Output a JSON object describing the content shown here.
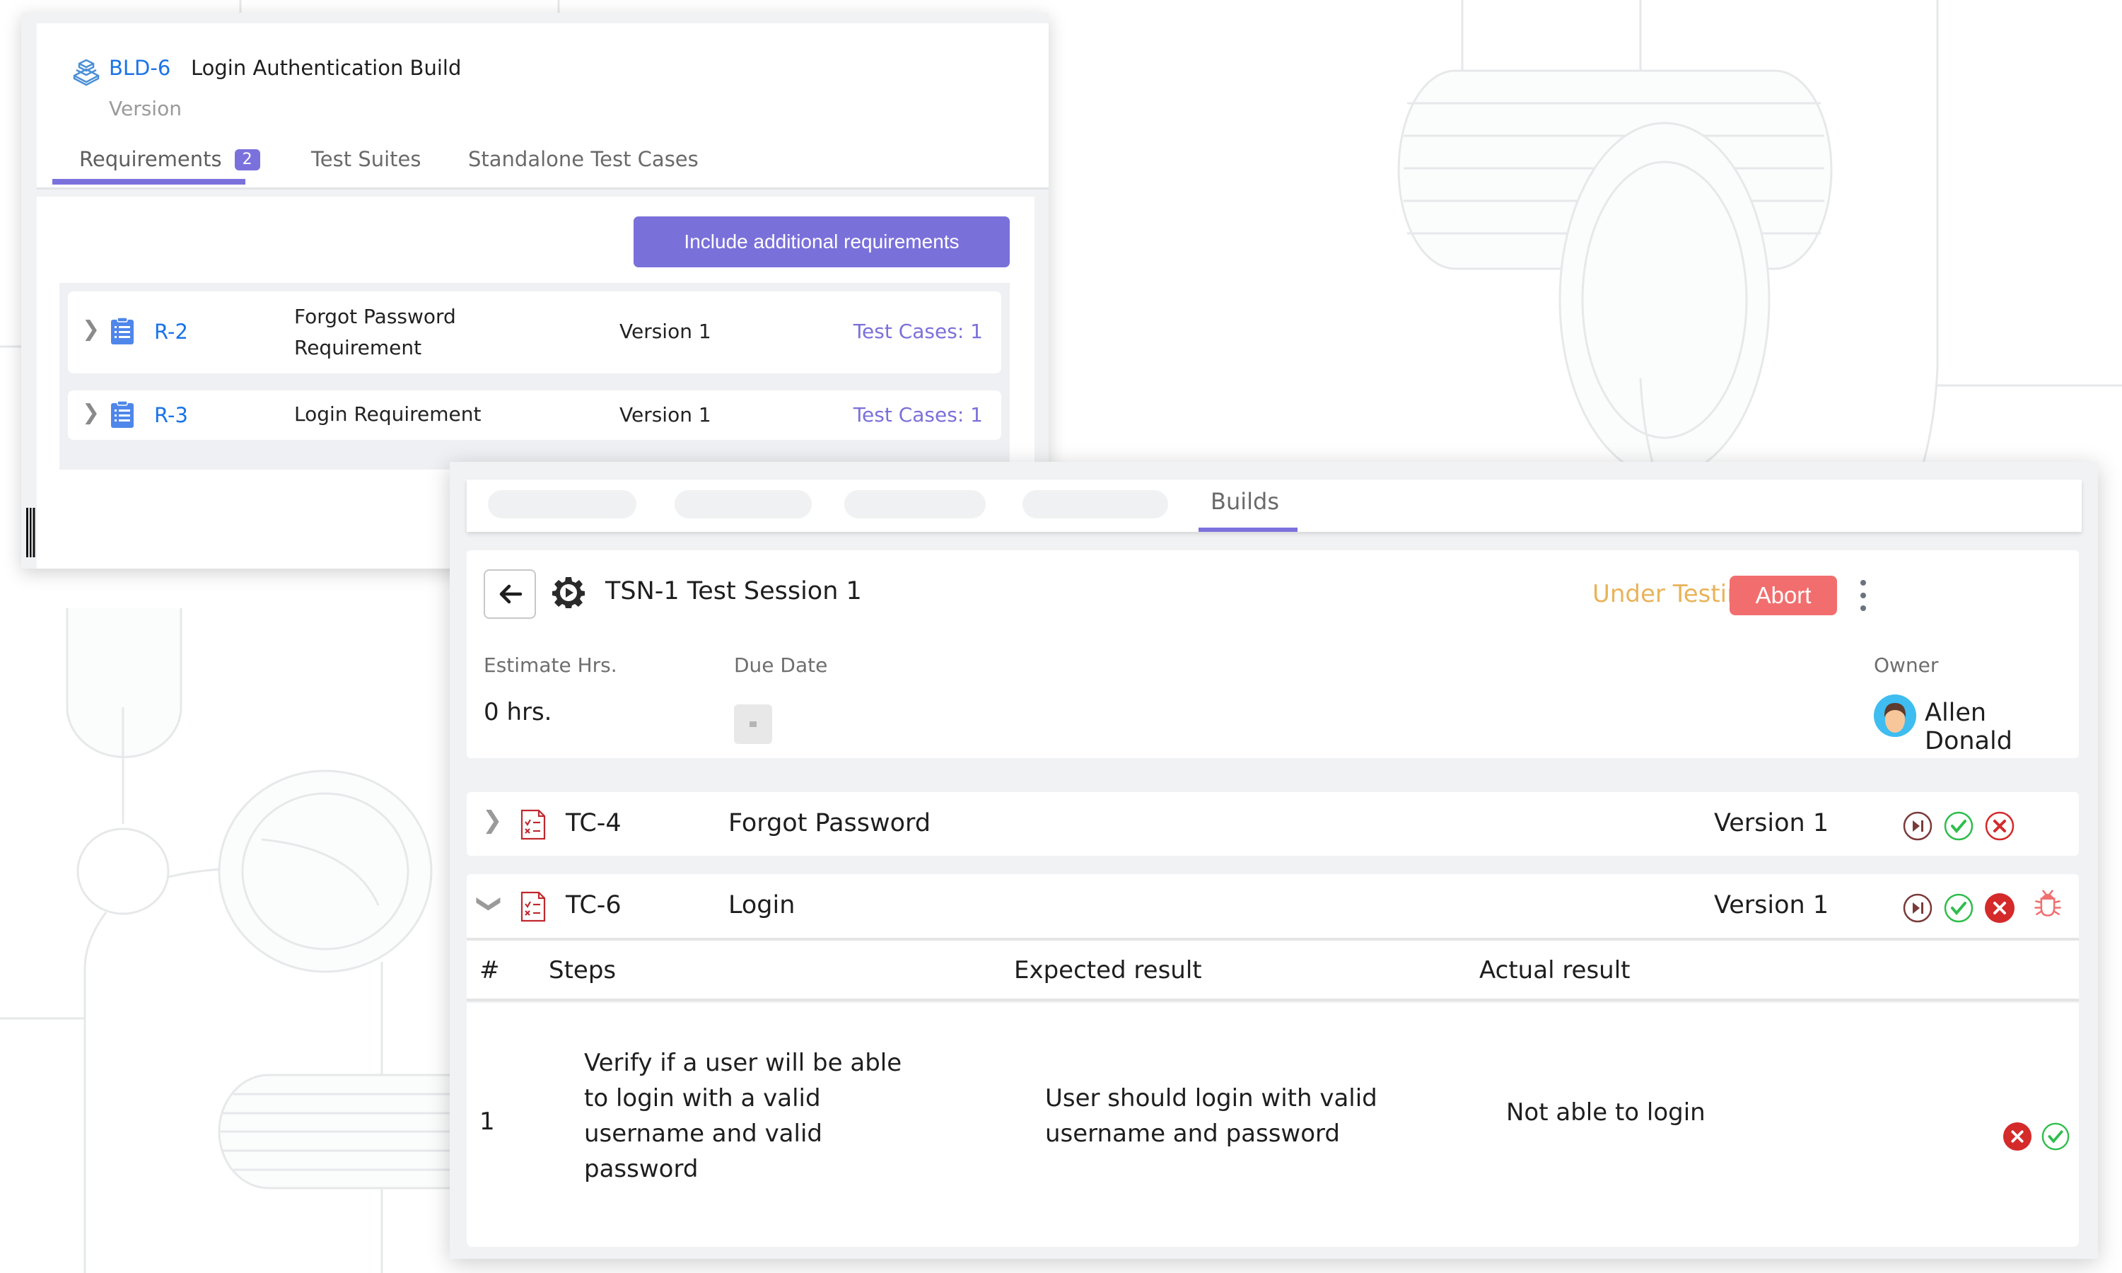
{
  "build_panel": {
    "key": "BLD-6",
    "title": "Login Authentication Build",
    "subtitle": "Version",
    "tabs": [
      {
        "label": "Requirements",
        "badge": "2",
        "active": true
      },
      {
        "label": "Test Suites",
        "active": false
      },
      {
        "label": "Standalone Test Cases",
        "active": false
      }
    ],
    "include_button_label": "Include additional requirements",
    "requirements": [
      {
        "key": "R-2",
        "name": "Forgot Password Requirement",
        "name_lines": [
          "Forgot Password",
          "Requirement"
        ],
        "version": "Version 1",
        "test_cases": "Test Cases: 1"
      },
      {
        "key": "R-3",
        "name": "Login Requirement",
        "name_lines": [
          "Login Requirement"
        ],
        "version": "Version 1",
        "test_cases": "Test Cases: 1"
      }
    ]
  },
  "session_panel": {
    "tabs": [
      {
        "label": "",
        "placeholder": true
      },
      {
        "label": "",
        "placeholder": true
      },
      {
        "label": "",
        "placeholder": true
      },
      {
        "label": "",
        "placeholder": true
      },
      {
        "label": "Builds",
        "active": true
      }
    ],
    "title": "TSN-1 Test Session 1",
    "status": "Under Testing",
    "abort_label": "Abort",
    "estimate_label": "Estimate Hrs.",
    "estimate_value": "0 hrs.",
    "due_date_label": "Due Date",
    "due_date_value": "-",
    "owner_label": "Owner",
    "owner_name": "Allen Donald",
    "test_cases": [
      {
        "key": "TC-4",
        "name": "Forgot Password",
        "version": "Version 1",
        "expanded": false,
        "actions": [
          "skip",
          "pass",
          "fail"
        ],
        "result": "none"
      },
      {
        "key": "TC-6",
        "name": "Login",
        "version": "Version 1",
        "expanded": true,
        "actions": [
          "skip",
          "pass",
          "fail",
          "bug"
        ],
        "result": "fail"
      }
    ],
    "steps_table": {
      "headers": {
        "num": "#",
        "steps": "Steps",
        "expected": "Expected result",
        "actual": "Actual result"
      },
      "rows": [
        {
          "num": "1",
          "steps_lines": [
            "Verify if a user will be able",
            "to login with a valid",
            "username and valid",
            "password"
          ],
          "expected_lines": [
            "User should login with valid",
            "username and password"
          ],
          "actual": "Not able to login",
          "result": "fail"
        }
      ]
    }
  },
  "colors": {
    "accent": "#7b71dc",
    "link_blue": "#1a73e8",
    "status_under_testing": "#e9b35a",
    "abort": "#f26e6e",
    "pass": "#2ebd4b",
    "fail": "#d42a2a",
    "skip": "#7a3a3a"
  }
}
